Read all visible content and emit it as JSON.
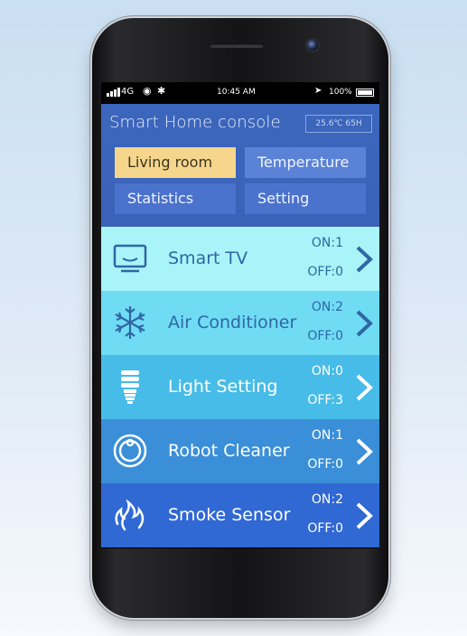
{
  "status_bar": {
    "network": "4G",
    "time": "10:45 AM",
    "battery": "100%"
  },
  "app": {
    "title": "Smart Home console",
    "readout": "25.6℃  65H"
  },
  "tabs": [
    {
      "label": "Living room",
      "active": true
    },
    {
      "label": "Temperature",
      "active": false
    },
    {
      "label": "Statistics",
      "active": false
    },
    {
      "label": "Setting",
      "active": false
    }
  ],
  "devices": [
    {
      "name": "Smart TV",
      "on": "ON:1",
      "off": "OFF:0",
      "icon": "tv-icon",
      "color": "#a9f4f8"
    },
    {
      "name": "Air Conditioner",
      "on": "ON:2",
      "off": "OFF:0",
      "icon": "snowflake-icon",
      "color": "#6fdcf4"
    },
    {
      "name": "Light Setting",
      "on": "ON:0",
      "off": "OFF:3",
      "icon": "light-bulb-icon",
      "color": "#47bce8"
    },
    {
      "name": "Robot Cleaner",
      "on": "ON:1",
      "off": "OFF:0",
      "icon": "robot-cleaner-icon",
      "color": "#3a8fd8"
    },
    {
      "name": "Smoke Sensor",
      "on": "ON:2",
      "off": "OFF:0",
      "icon": "flame-icon",
      "color": "#3068d4"
    }
  ]
}
